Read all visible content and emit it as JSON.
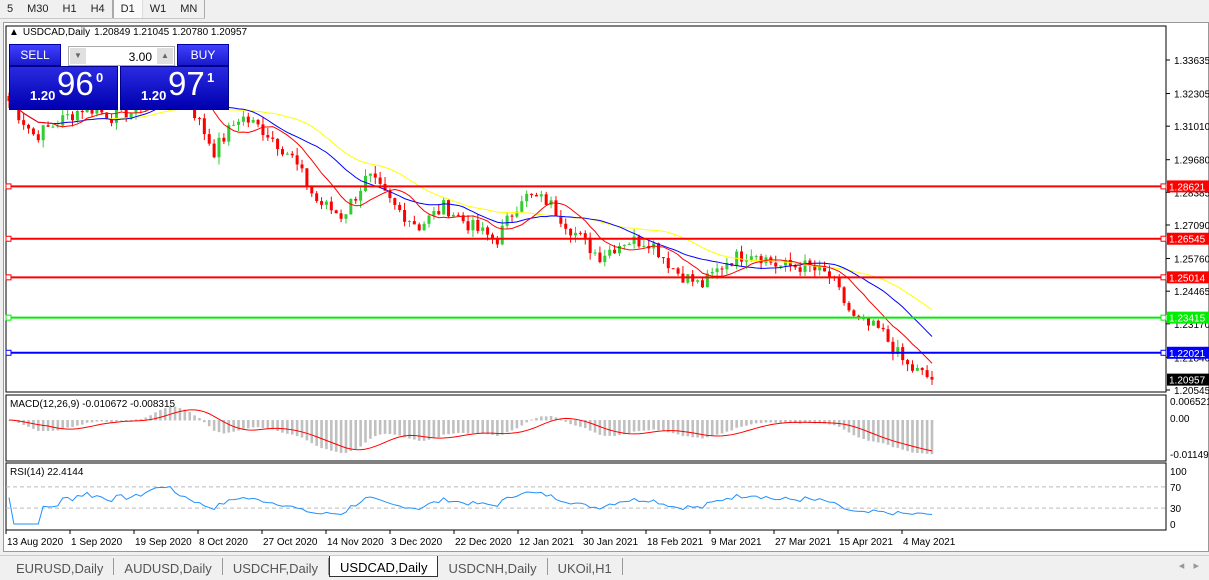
{
  "timeframes": [
    "5",
    "M30",
    "H1",
    "H4",
    "D1",
    "W1",
    "MN"
  ],
  "active_timeframe": "D1",
  "chart": {
    "title": "USDCAD,Daily",
    "ohlc": "1.20849 1.21045 1.20780 1.20957"
  },
  "trade_panel": {
    "sell_label": "SELL",
    "buy_label": "BUY",
    "lot": "3.00",
    "sell_prefix": "1.20",
    "sell_big": "96",
    "sell_sup": "0",
    "buy_prefix": "1.20",
    "buy_big": "97",
    "buy_sup": "1"
  },
  "macd": {
    "label": "MACD(12,26,9) -0.010672 -0.008315",
    "ticks": [
      "0.006521",
      "0.00",
      "-0.01149"
    ]
  },
  "rsi": {
    "label": "RSI(14) 22.4144",
    "ticks": [
      "100",
      "70",
      "30",
      "0"
    ]
  },
  "chart_data": {
    "type": "candlestick",
    "symbol": "USDCAD",
    "timeframe": "Daily",
    "price_ticks": [
      1.33635,
      1.32305,
      1.3101,
      1.2968,
      1.28385,
      1.2709,
      1.2576,
      1.24465,
      1.2317,
      1.2184,
      1.20545
    ],
    "ylim": [
      1.2045,
      1.3485
    ],
    "date_labels": [
      "13 Aug 2020",
      "1 Sep 2020",
      "19 Sep 2020",
      "8 Oct 2020",
      "27 Oct 2020",
      "14 Nov 2020",
      "3 Dec 2020",
      "22 Dec 2020",
      "12 Jan 2021",
      "30 Jan 2021",
      "18 Feb 2021",
      "9 Mar 2021",
      "27 Mar 2021",
      "15 Apr 2021",
      "4 May 2021"
    ],
    "close_anchors": [
      1.3201,
      1.3062,
      1.3122,
      1.3181,
      1.3141,
      1.3161,
      1.334,
      1.3201,
      1.3003,
      1.3141,
      1.3082,
      1.2983,
      1.2804,
      1.2745,
      1.2903,
      1.2784,
      1.2705,
      1.2784,
      1.2705,
      1.2646,
      1.2824,
      1.2804,
      1.2685,
      1.2586,
      1.2646,
      1.2646,
      1.2527,
      1.2467,
      1.2566,
      1.2606,
      1.2546,
      1.2546,
      1.2507,
      1.2328,
      1.2289,
      1.215,
      1.20957
    ],
    "last_price": "1.20957",
    "horizontal_lines": [
      {
        "price": "1.28621",
        "color": "#ff0000"
      },
      {
        "price": "1.26545",
        "color": "#ff0000"
      },
      {
        "price": "1.25014",
        "color": "#ff0000"
      },
      {
        "price": "1.23415",
        "color": "#00ee00"
      },
      {
        "price": "1.22021",
        "color": "#0000ff"
      }
    ],
    "colors": {
      "bull": "#32cd32",
      "bear": "#ff0000",
      "ma_fast": "#ff0000",
      "ma_mid": "#0000ff",
      "ma_slow": "#ffff00",
      "macd_hist": "#c0c0c0",
      "macd_signal": "#ff0000",
      "rsi": "#1e90ff"
    }
  },
  "symbol_tabs": [
    "EURUSD,Daily",
    "AUDUSD,Daily",
    "USDCHF,Daily",
    "USDCAD,Daily",
    "USDCNH,Daily",
    "UKOil,H1"
  ],
  "active_tab": "USDCAD,Daily"
}
